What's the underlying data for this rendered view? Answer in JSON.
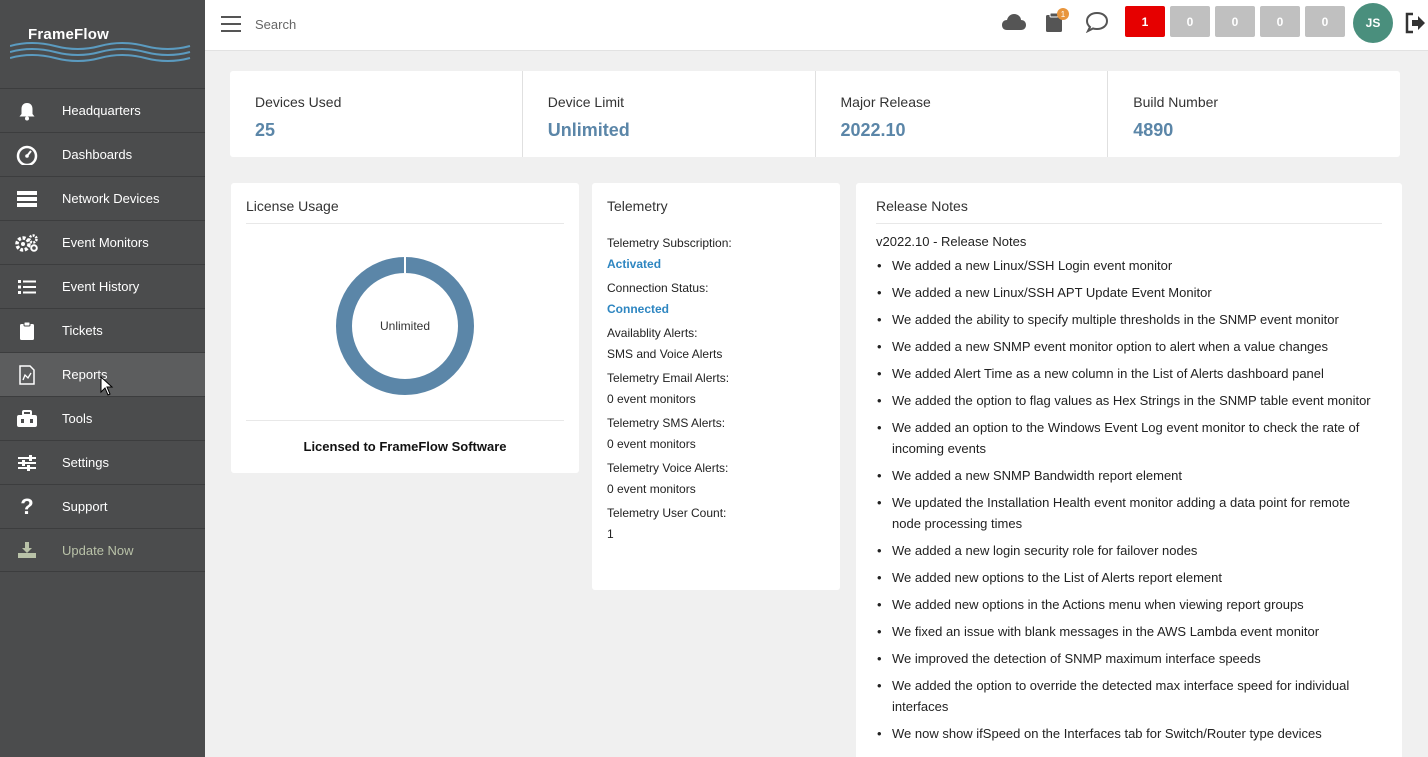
{
  "app": {
    "brand": "FrameFlow"
  },
  "sidebar": {
    "items": [
      {
        "label": "Headquarters",
        "icon": "bell-icon"
      },
      {
        "label": "Dashboards",
        "icon": "gauge-icon"
      },
      {
        "label": "Network Devices",
        "icon": "server-icon"
      },
      {
        "label": "Event Monitors",
        "icon": "gears-icon"
      },
      {
        "label": "Event History",
        "icon": "list-icon"
      },
      {
        "label": "Tickets",
        "icon": "clipboard-icon"
      },
      {
        "label": "Reports",
        "icon": "report-icon"
      },
      {
        "label": "Tools",
        "icon": "toolbox-icon"
      },
      {
        "label": "Settings",
        "icon": "sliders-icon"
      },
      {
        "label": "Support",
        "icon": "question-icon"
      },
      {
        "label": "Update Now",
        "icon": "download-icon"
      }
    ]
  },
  "topbar": {
    "search_placeholder": "Search",
    "tickets_badge": "1",
    "counters": [
      "1",
      "0",
      "0",
      "0",
      "0"
    ],
    "counter_colors": [
      "#e60000",
      "#c0c0c0",
      "#c0c0c0",
      "#c0c0c0",
      "#c0c0c0"
    ],
    "avatar_initials": "JS"
  },
  "stats": [
    {
      "label": "Devices Used",
      "value": "25"
    },
    {
      "label": "Device Limit",
      "value": "Unlimited"
    },
    {
      "label": "Major Release",
      "value": "2022.10"
    },
    {
      "label": "Build Number",
      "value": "4890"
    }
  ],
  "license": {
    "title": "License Usage",
    "donut_label": "Unlimited",
    "licensed_to": "Licensed to FrameFlow Software",
    "ring_color": "#5b86a8"
  },
  "telemetry": {
    "title": "Telemetry",
    "rows": [
      {
        "key": "Telemetry Subscription:",
        "value": "Activated",
        "highlight": true
      },
      {
        "key": "Connection Status:",
        "value": "Connected",
        "highlight": true
      },
      {
        "key": "Availablity Alerts:",
        "value": "SMS and Voice Alerts",
        "highlight": false
      },
      {
        "key": "Telemetry Email Alerts:",
        "value": "0 event monitors",
        "highlight": false
      },
      {
        "key": "Telemetry SMS Alerts:",
        "value": "0 event monitors",
        "highlight": false
      },
      {
        "key": "Telemetry Voice Alerts:",
        "value": "0 event monitors",
        "highlight": false
      },
      {
        "key": "Telemetry User Count:",
        "value": "1",
        "highlight": false
      }
    ]
  },
  "release_notes": {
    "title": "Release Notes",
    "heading": "v2022.10 - Release Notes",
    "items": [
      "We added a new Linux/SSH Login event monitor",
      "We added a new Linux/SSH APT Update Event Monitor",
      "We added the ability to specify multiple thresholds in the SNMP event monitor",
      "We added a new SNMP event monitor option to alert when a value changes",
      "We added Alert Time as a new column in the List of Alerts dashboard panel",
      "We added the option to flag values as Hex Strings in the SNMP table event monitor",
      "We added an option to the Windows Event Log event monitor to check the rate of incoming events",
      "We added a new SNMP Bandwidth report element",
      "We updated the Installation Health event monitor adding a data point for remote node processing times",
      "We added a new login security role for failover nodes",
      "We added new options to the List of Alerts report element",
      "We added new options in the Actions menu when viewing report groups",
      "We fixed an issue with blank messages in the AWS Lambda event monitor",
      "We improved the detection of SNMP maximum interface speeds",
      "We added the option to override the detected max interface speed for individual interfaces",
      "We now show ifSpeed on the Interfaces tab for Switch/Router type devices"
    ]
  }
}
